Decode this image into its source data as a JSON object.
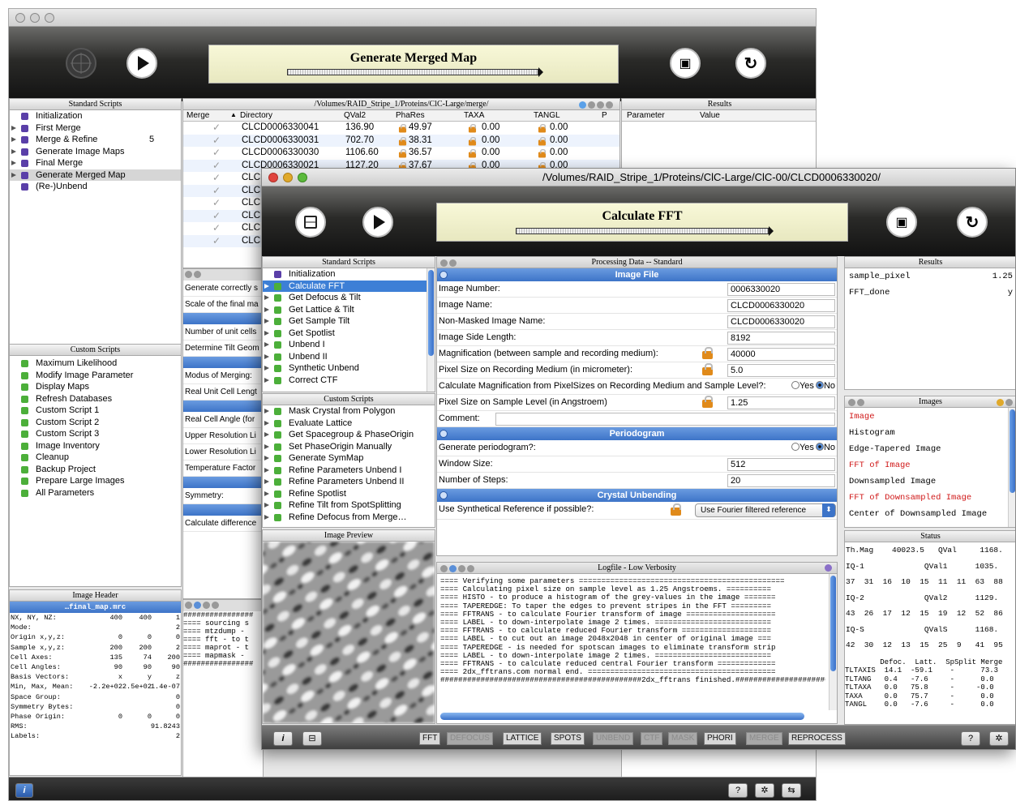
{
  "back": {
    "title": "Generate Merged Map",
    "path": "/Volumes/RAID_Stripe_1/Proteins/ClC-Large/merge/",
    "std_head": "Standard Scripts",
    "std": [
      {
        "label": "Initialization",
        "exp": false
      },
      {
        "label": "First Merge",
        "exp": true
      },
      {
        "label": "Merge & Refine",
        "exp": true,
        "count": "5"
      },
      {
        "label": "Generate Image Maps",
        "exp": true
      },
      {
        "label": "Final Merge",
        "exp": true
      },
      {
        "label": "Generate Merged Map",
        "exp": true,
        "sel": true
      },
      {
        "label": "(Re-)Unbend",
        "exp": false
      }
    ],
    "custom_head": "Custom Scripts",
    "custom": [
      "Maximum Likelihood",
      "Modify Image Parameter",
      "Display Maps",
      "Refresh Databases",
      "Custom Script 1",
      "Custom Script 2",
      "Custom Script 3",
      "Image Inventory",
      "Cleanup",
      "Backup Project",
      "Prepare Large Images",
      "All Parameters"
    ],
    "table_cols": [
      "Merge",
      "Directory",
      "QVal2",
      "PhaRes",
      "TAXA",
      "TANGL",
      "P"
    ],
    "table_rows": [
      {
        "dir": "CLCD0006330041",
        "q": "136.90",
        "ph": "49.97",
        "taxa": "0.00",
        "tangl": "0.00"
      },
      {
        "dir": "CLCD0006330031",
        "q": "702.70",
        "ph": "38.31",
        "taxa": "0.00",
        "tangl": "0.00"
      },
      {
        "dir": "CLCD0006330030",
        "q": "1106.60",
        "ph": "36.57",
        "taxa": "0.00",
        "tangl": "0.00"
      },
      {
        "dir": "CLCD0006330021",
        "q": "1127.20",
        "ph": "37.67",
        "taxa": "0.00",
        "tangl": "0.00"
      },
      {
        "dir": "CLCD",
        "q": "",
        "ph": "",
        "taxa": "",
        "tangl": ""
      },
      {
        "dir": "CLCD",
        "q": "",
        "ph": "",
        "taxa": "",
        "tangl": ""
      },
      {
        "dir": "CLCD",
        "q": "",
        "ph": "",
        "taxa": "",
        "tangl": ""
      },
      {
        "dir": "CLCD",
        "q": "",
        "ph": "",
        "taxa": "",
        "tangl": ""
      },
      {
        "dir": "CLCD",
        "q": "",
        "ph": "",
        "taxa": "",
        "tangl": ""
      },
      {
        "dir": "CLCD",
        "q": "",
        "ph": "",
        "taxa": "",
        "tangl": ""
      }
    ],
    "results_head": "Results",
    "results_cols": [
      "Parameter",
      "Value"
    ],
    "params": [
      "Generate correctly s",
      "Scale of the final ma",
      "Number of unit cells",
      "Determine Tilt Geom",
      "Modus of Merging:",
      "Real Unit Cell Lengt",
      "Real Cell Angle (for",
      "Upper Resolution Li",
      "Lower Resolution Li",
      "Temperature Factor",
      "Symmetry:",
      "Calculate difference"
    ],
    "log_lines": [
      "################",
      "==== sourcing s",
      "==== mtzdump -",
      "==== fft - to t",
      "==== maprot - t",
      "==== mapmask -",
      "################"
    ],
    "imghdr_head": "Image Header",
    "imghdr_file": "…final_map.mrc",
    "imghdr": [
      {
        "k": "NX, NY, NZ:",
        "a": "400",
        "b": "400",
        "c": "1"
      },
      {
        "k": "Mode:",
        "a": "",
        "b": "",
        "c": "2"
      },
      {
        "k": "Origin x,y,z:",
        "a": "0",
        "b": "0",
        "c": "0"
      },
      {
        "k": "Sample x,y,z:",
        "a": "200",
        "b": "200",
        "c": "2"
      },
      {
        "k": "Cell Axes:",
        "a": "135",
        "b": "74",
        "c": "200"
      },
      {
        "k": "Cell Angles:",
        "a": "90",
        "b": "90",
        "c": "90"
      },
      {
        "k": "Basis Vectors:",
        "a": "x",
        "b": "y",
        "c": "z"
      },
      {
        "k": "Min, Max, Mean:",
        "a": "-2.2e+02",
        "b": "2.5e+02",
        "c": "1.4e-07"
      },
      {
        "k": "Space Group:",
        "a": "",
        "b": "",
        "c": "0"
      },
      {
        "k": "Symmetry Bytes:",
        "a": "",
        "b": "",
        "c": "0"
      },
      {
        "k": "Phase Origin:",
        "a": "0",
        "b": "0",
        "c": "0"
      },
      {
        "k": "RMS:",
        "a": "",
        "b": "",
        "c": "91.8243"
      },
      {
        "k": "Labels:",
        "a": "",
        "b": "",
        "c": "2"
      }
    ]
  },
  "front": {
    "path": "/Volumes/RAID_Stripe_1/Proteins/ClC-Large/ClC-00/CLCD0006330020/",
    "title": "Calculate FFT",
    "std_head": "Standard Scripts",
    "std": [
      "Initialization",
      "Calculate FFT",
      "Get Defocus & Tilt",
      "Get Lattice & Tilt",
      "Get Sample Tilt",
      "Get Spotlist",
      "Unbend I",
      "Unbend II",
      "Synthetic Unbend",
      "Correct CTF"
    ],
    "custom_head": "Custom Scripts",
    "custom": [
      "Mask Crystal from Polygon",
      "Evaluate Lattice",
      "Get Spacegroup & PhaseOrigin",
      "Set PhaseOrigin Manually",
      "Generate SymMap",
      "Refine Parameters Unbend I",
      "Refine Parameters Unbend II",
      "Refine Spotlist",
      "Refine Tilt from SpotSplitting",
      "Refine Defocus from Merge…"
    ],
    "preview_head": "Image Preview",
    "proc_head": "Processing Data -- Standard",
    "sec_image": "Image File",
    "image_fields": [
      {
        "label": "Image Number:",
        "value": "0006330020"
      },
      {
        "label": "Image Name:",
        "value": "CLCD0006330020"
      },
      {
        "label": "Non-Masked Image Name:",
        "value": "CLCD0006330020"
      },
      {
        "label": "Image Side Length:",
        "value": "8192"
      },
      {
        "label": "Magnification (between sample and recording medium):",
        "value": "40000",
        "lock": true
      },
      {
        "label": "Pixel Size on Recording Medium (in micrometer):",
        "value": "5.0",
        "lock": true
      }
    ],
    "calcmag_label": "Calculate Magnification from PixelSizes on Recording Medium and Sample Level?:",
    "yes": "Yes",
    "no": "No",
    "pixel_sample_label": "Pixel Size on Sample Level (in Angstroem)",
    "pixel_sample_value": "1.25",
    "comment_label": "Comment:",
    "sec_period": "Periodogram",
    "gen_period_label": "Generate periodogram?:",
    "window_label": "Window Size:",
    "window_value": "512",
    "steps_label": "Number of Steps:",
    "steps_value": "20",
    "sec_crystal": "Crystal Unbending",
    "synth_label": "Use Synthetical Reference if possible?:",
    "synth_select": "Use Fourier filtered reference",
    "results_head": "Results",
    "results": [
      {
        "k": "sample_pixel",
        "v": "1.25"
      },
      {
        "k": "FFT_done",
        "v": "y"
      }
    ],
    "images_head": "Images",
    "images": [
      {
        "t": "Image",
        "red": true
      },
      {
        "t": "Histogram",
        "red": false
      },
      {
        "t": "Edge-Tapered Image",
        "red": false
      },
      {
        "t": "FFT of Image",
        "red": true
      },
      {
        "t": "Downsampled Image",
        "red": false
      },
      {
        "t": "FFT of Downsampled Image",
        "red": true
      },
      {
        "t": "Center of Downsampled Image",
        "red": false
      }
    ],
    "status_head": "Status",
    "status_lines": [
      "Th.Mag    40023.5   QVal     1168.",
      "IQ-1             QVal1      1035.",
      "37  31  16  10  15  11  11  63  88",
      "IQ-2             QVal2      1129.",
      "43  26  17  12  15  19  12  52  86",
      "IQ-S             QValS      1168.",
      "42  30  12  13  15  25  9   41  95"
    ],
    "status_table": [
      "        Defoc.  Latt.  SpSplit Merge",
      "TLTAXIS  14.1  -59.1    -      73.3",
      "TLTANG   0.4   -7.6     -      0.0",
      "TLTAXA   0.0   75.8     -     -0.0",
      "TAXA     0.0   75.7     -      0.0",
      "TANGL    0.0   -7.6     -      0.0"
    ],
    "log_head": "Logfile - Low Verbosity",
    "log": [
      "==== Verifying some parameters ==============================================",
      "==== Calculating pixel size on sample level as 1.25 Angstroems. ==========",
      "==== HISTO - to produce a histogram of the grey-values in the image =======",
      "==== TAPEREDGE: To taper the edges to prevent stripes in the FFT =========",
      "==== FFTRANS - to calculate Fourier transform of image ====================",
      "==== LABEL - to down-interpolate image 2 times. ==========================",
      "==== FFTRANS - to calculate reduced Fourier transform ====================",
      "==== LABEL - to cut out an image 2048x2048 in center of original image ===",
      "==== TAPEREDGE - is needed for spotscan images to eliminate transform strip",
      "==== LABEL - to down-interpolate image 2 times. ==========================",
      "==== FFTRANS - to calculate reduced central Fourier transform =============",
      "==== 2dx_fftrans.com normal end. ==========================================",
      "#############################################2dx_fftrans finished.#########################"
    ],
    "bottom_buttons": [
      {
        "t": "FFT",
        "dim": false
      },
      {
        "t": "DEFOCUS",
        "dim": true
      },
      {
        "t": "LATTICE",
        "dim": false
      },
      {
        "t": "SPOTS",
        "dim": false
      },
      {
        "t": "UNBEND",
        "dim": true
      },
      {
        "t": "CTF",
        "dim": true
      },
      {
        "t": "MASK",
        "dim": true
      },
      {
        "t": "PHORI",
        "dim": false
      },
      {
        "t": "MERGE",
        "dim": true
      },
      {
        "t": "REPROCESS",
        "dim": false
      }
    ],
    "info_icon": "i",
    "help_icon": "?"
  }
}
